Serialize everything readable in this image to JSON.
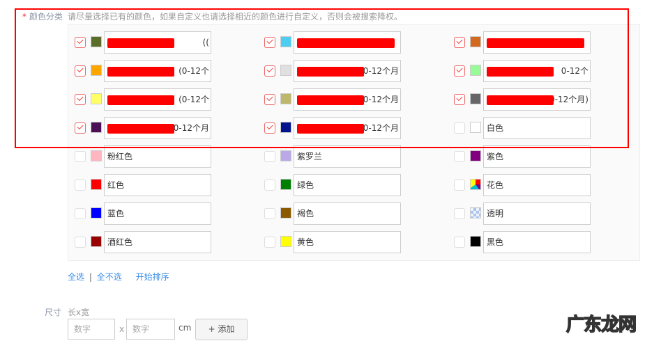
{
  "color_section": {
    "required_mark": "*",
    "label": "颜色分类",
    "hint": "请尽量选择已有的颜色，如果自定义也请选择相近的颜色进行自定义，否则会被搜索降权。",
    "items": [
      {
        "color": "#5a6e2a",
        "checked": true,
        "text": "((",
        "redacted": true
      },
      {
        "color": "#4ccdf2",
        "checked": true,
        "text": "",
        "redacted": true
      },
      {
        "color": "#d2691e",
        "checked": true,
        "text": "",
        "redacted": true
      },
      {
        "color": "#ffa500",
        "checked": true,
        "text": "(0-12个",
        "redacted": true
      },
      {
        "color": "#e0e0e0",
        "checked": true,
        "text": "(0-12个月",
        "redacted": true
      },
      {
        "color": "#98fb98",
        "checked": true,
        "text": "0-12个",
        "redacted": true
      },
      {
        "color": "#ffff66",
        "checked": true,
        "text": "(0-12个",
        "redacted": true
      },
      {
        "color": "#bdb76b",
        "checked": true,
        "text": "0-12个月",
        "redacted": true
      },
      {
        "color": "#666666",
        "checked": true,
        "text": "(0-12个月)",
        "redacted": true
      },
      {
        "color": "#4b0f55",
        "checked": true,
        "text": "(0-12个月",
        "redacted": true
      },
      {
        "color": "#00128c",
        "checked": true,
        "text": "(0-12个月",
        "redacted": true
      },
      {
        "color": "#ffffff",
        "checked": false,
        "text": "白色",
        "redacted": false
      },
      {
        "color": "#ffb6c1",
        "checked": false,
        "text": "粉红色",
        "redacted": false
      },
      {
        "color": "#b9a9e6",
        "checked": false,
        "text": "紫罗兰",
        "redacted": false
      },
      {
        "color": "#800080",
        "checked": false,
        "text": "紫色",
        "redacted": false
      },
      {
        "color": "#ff0000",
        "checked": false,
        "text": "红色",
        "redacted": false
      },
      {
        "color": "#008000",
        "checked": false,
        "text": "绿色",
        "redacted": false
      },
      {
        "color": "multicolor",
        "checked": false,
        "text": "花色",
        "redacted": false
      },
      {
        "color": "#0000ff",
        "checked": false,
        "text": "蓝色",
        "redacted": false
      },
      {
        "color": "#8b5a00",
        "checked": false,
        "text": "褐色",
        "redacted": false
      },
      {
        "color": "transparent",
        "checked": false,
        "text": "透明",
        "redacted": false
      },
      {
        "color": "#990000",
        "checked": false,
        "text": "酒红色",
        "redacted": false
      },
      {
        "color": "#ffff00",
        "checked": false,
        "text": "黄色",
        "redacted": false
      },
      {
        "color": "#000000",
        "checked": false,
        "text": "黑色",
        "redacted": false
      }
    ],
    "select_all": "全选",
    "separator": "|",
    "select_none": "全不选",
    "start_sort": "开始排序"
  },
  "size_section": {
    "label": "尺寸",
    "sublabel": "长x宽",
    "length_placeholder": "数字",
    "times": "x",
    "width_placeholder": "数字",
    "unit": "cm",
    "add_button": "+ 添加"
  },
  "watermark": "广东龙网"
}
